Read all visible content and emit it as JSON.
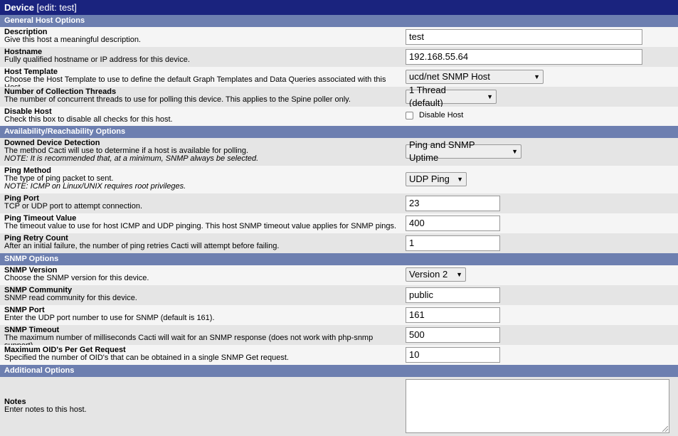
{
  "title": {
    "main": "Device",
    "sub": "[edit: test]"
  },
  "sections": {
    "general": "General Host Options",
    "availability": "Availability/Reachability Options",
    "snmp": "SNMP Options",
    "additional": "Additional Options"
  },
  "fields": {
    "description": {
      "title": "Description",
      "desc": "Give this host a meaningful description.",
      "value": "test"
    },
    "hostname": {
      "title": "Hostname",
      "desc": "Fully qualified hostname or IP address for this device.",
      "value": "192.168.55.64"
    },
    "host_template": {
      "title": "Host Template",
      "desc": "Choose the Host Template to use to define the default Graph Templates and Data Queries associated with this Host.",
      "value": "ucd/net SNMP Host"
    },
    "threads": {
      "title": "Number of Collection Threads",
      "desc": "The number of concurrent threads to use for polling this device. This applies to the Spine poller only.",
      "value": "1 Thread (default)"
    },
    "disable": {
      "title": "Disable Host",
      "desc": "Check this box to disable all checks for this host.",
      "checkbox_label": "Disable Host",
      "checked": false
    },
    "downed": {
      "title": "Downed Device Detection",
      "desc": "The method Cacti will use to determine if a host is available for polling.",
      "note": "NOTE: It is recommended that, at a minimum, SNMP always be selected.",
      "value": "Ping and SNMP Uptime"
    },
    "ping_method": {
      "title": "Ping Method",
      "desc": "The type of ping packet to sent.",
      "note": "NOTE: ICMP on Linux/UNIX requires root privileges.",
      "value": "UDP Ping"
    },
    "ping_port": {
      "title": "Ping Port",
      "desc": "TCP or UDP port to attempt connection.",
      "value": "23"
    },
    "ping_timeout": {
      "title": "Ping Timeout Value",
      "desc": "The timeout value to use for host ICMP and UDP pinging. This host SNMP timeout value applies for SNMP pings.",
      "value": "400"
    },
    "ping_retry": {
      "title": "Ping Retry Count",
      "desc": "After an initial failure, the number of ping retries Cacti will attempt before failing.",
      "value": "1"
    },
    "snmp_version": {
      "title": "SNMP Version",
      "desc": "Choose the SNMP version for this device.",
      "value": "Version 2"
    },
    "snmp_community": {
      "title": "SNMP Community",
      "desc": "SNMP read community for this device.",
      "value": "public"
    },
    "snmp_port": {
      "title": "SNMP Port",
      "desc": "Enter the UDP port number to use for SNMP (default is 161).",
      "value": "161"
    },
    "snmp_timeout": {
      "title": "SNMP Timeout",
      "desc": "The maximum number of milliseconds Cacti will wait for an SNMP response (does not work with php-snmp support).",
      "value": "500"
    },
    "max_oids": {
      "title": "Maximum OID's Per Get Request",
      "desc": "Specified the number of OID's that can be obtained in a single SNMP Get request.",
      "value": "10"
    },
    "notes": {
      "title": "Notes",
      "desc": "Enter notes to this host.",
      "value": ""
    }
  },
  "icons": {
    "dropdown": "triangle-down-icon",
    "resize": "resize-grip-icon"
  },
  "colors": {
    "title_bg": "#1a237e",
    "section_bg": "#6d7fb0",
    "row_light": "#f5f5f5",
    "row_dark": "#e5e5e5"
  }
}
